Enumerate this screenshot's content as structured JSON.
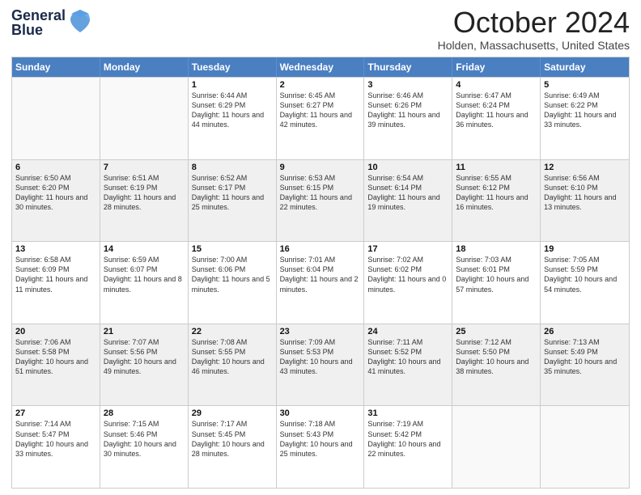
{
  "logo": {
    "line1": "General",
    "line2": "Blue",
    "aria": "GeneralBlue logo"
  },
  "title": "October 2024",
  "location": "Holden, Massachusetts, United States",
  "days_of_week": [
    "Sunday",
    "Monday",
    "Tuesday",
    "Wednesday",
    "Thursday",
    "Friday",
    "Saturday"
  ],
  "weeks": [
    [
      {
        "day": "",
        "empty": true
      },
      {
        "day": "",
        "empty": true
      },
      {
        "day": "1",
        "sunrise": "Sunrise: 6:44 AM",
        "sunset": "Sunset: 6:29 PM",
        "daylight": "Daylight: 11 hours and 44 minutes."
      },
      {
        "day": "2",
        "sunrise": "Sunrise: 6:45 AM",
        "sunset": "Sunset: 6:27 PM",
        "daylight": "Daylight: 11 hours and 42 minutes."
      },
      {
        "day": "3",
        "sunrise": "Sunrise: 6:46 AM",
        "sunset": "Sunset: 6:26 PM",
        "daylight": "Daylight: 11 hours and 39 minutes."
      },
      {
        "day": "4",
        "sunrise": "Sunrise: 6:47 AM",
        "sunset": "Sunset: 6:24 PM",
        "daylight": "Daylight: 11 hours and 36 minutes."
      },
      {
        "day": "5",
        "sunrise": "Sunrise: 6:49 AM",
        "sunset": "Sunset: 6:22 PM",
        "daylight": "Daylight: 11 hours and 33 minutes."
      }
    ],
    [
      {
        "day": "6",
        "sunrise": "Sunrise: 6:50 AM",
        "sunset": "Sunset: 6:20 PM",
        "daylight": "Daylight: 11 hours and 30 minutes."
      },
      {
        "day": "7",
        "sunrise": "Sunrise: 6:51 AM",
        "sunset": "Sunset: 6:19 PM",
        "daylight": "Daylight: 11 hours and 28 minutes."
      },
      {
        "day": "8",
        "sunrise": "Sunrise: 6:52 AM",
        "sunset": "Sunset: 6:17 PM",
        "daylight": "Daylight: 11 hours and 25 minutes."
      },
      {
        "day": "9",
        "sunrise": "Sunrise: 6:53 AM",
        "sunset": "Sunset: 6:15 PM",
        "daylight": "Daylight: 11 hours and 22 minutes."
      },
      {
        "day": "10",
        "sunrise": "Sunrise: 6:54 AM",
        "sunset": "Sunset: 6:14 PM",
        "daylight": "Daylight: 11 hours and 19 minutes."
      },
      {
        "day": "11",
        "sunrise": "Sunrise: 6:55 AM",
        "sunset": "Sunset: 6:12 PM",
        "daylight": "Daylight: 11 hours and 16 minutes."
      },
      {
        "day": "12",
        "sunrise": "Sunrise: 6:56 AM",
        "sunset": "Sunset: 6:10 PM",
        "daylight": "Daylight: 11 hours and 13 minutes."
      }
    ],
    [
      {
        "day": "13",
        "sunrise": "Sunrise: 6:58 AM",
        "sunset": "Sunset: 6:09 PM",
        "daylight": "Daylight: 11 hours and 11 minutes."
      },
      {
        "day": "14",
        "sunrise": "Sunrise: 6:59 AM",
        "sunset": "Sunset: 6:07 PM",
        "daylight": "Daylight: 11 hours and 8 minutes."
      },
      {
        "day": "15",
        "sunrise": "Sunrise: 7:00 AM",
        "sunset": "Sunset: 6:06 PM",
        "daylight": "Daylight: 11 hours and 5 minutes."
      },
      {
        "day": "16",
        "sunrise": "Sunrise: 7:01 AM",
        "sunset": "Sunset: 6:04 PM",
        "daylight": "Daylight: 11 hours and 2 minutes."
      },
      {
        "day": "17",
        "sunrise": "Sunrise: 7:02 AM",
        "sunset": "Sunset: 6:02 PM",
        "daylight": "Daylight: 11 hours and 0 minutes."
      },
      {
        "day": "18",
        "sunrise": "Sunrise: 7:03 AM",
        "sunset": "Sunset: 6:01 PM",
        "daylight": "Daylight: 10 hours and 57 minutes."
      },
      {
        "day": "19",
        "sunrise": "Sunrise: 7:05 AM",
        "sunset": "Sunset: 5:59 PM",
        "daylight": "Daylight: 10 hours and 54 minutes."
      }
    ],
    [
      {
        "day": "20",
        "sunrise": "Sunrise: 7:06 AM",
        "sunset": "Sunset: 5:58 PM",
        "daylight": "Daylight: 10 hours and 51 minutes."
      },
      {
        "day": "21",
        "sunrise": "Sunrise: 7:07 AM",
        "sunset": "Sunset: 5:56 PM",
        "daylight": "Daylight: 10 hours and 49 minutes."
      },
      {
        "day": "22",
        "sunrise": "Sunrise: 7:08 AM",
        "sunset": "Sunset: 5:55 PM",
        "daylight": "Daylight: 10 hours and 46 minutes."
      },
      {
        "day": "23",
        "sunrise": "Sunrise: 7:09 AM",
        "sunset": "Sunset: 5:53 PM",
        "daylight": "Daylight: 10 hours and 43 minutes."
      },
      {
        "day": "24",
        "sunrise": "Sunrise: 7:11 AM",
        "sunset": "Sunset: 5:52 PM",
        "daylight": "Daylight: 10 hours and 41 minutes."
      },
      {
        "day": "25",
        "sunrise": "Sunrise: 7:12 AM",
        "sunset": "Sunset: 5:50 PM",
        "daylight": "Daylight: 10 hours and 38 minutes."
      },
      {
        "day": "26",
        "sunrise": "Sunrise: 7:13 AM",
        "sunset": "Sunset: 5:49 PM",
        "daylight": "Daylight: 10 hours and 35 minutes."
      }
    ],
    [
      {
        "day": "27",
        "sunrise": "Sunrise: 7:14 AM",
        "sunset": "Sunset: 5:47 PM",
        "daylight": "Daylight: 10 hours and 33 minutes."
      },
      {
        "day": "28",
        "sunrise": "Sunrise: 7:15 AM",
        "sunset": "Sunset: 5:46 PM",
        "daylight": "Daylight: 10 hours and 30 minutes."
      },
      {
        "day": "29",
        "sunrise": "Sunrise: 7:17 AM",
        "sunset": "Sunset: 5:45 PM",
        "daylight": "Daylight: 10 hours and 28 minutes."
      },
      {
        "day": "30",
        "sunrise": "Sunrise: 7:18 AM",
        "sunset": "Sunset: 5:43 PM",
        "daylight": "Daylight: 10 hours and 25 minutes."
      },
      {
        "day": "31",
        "sunrise": "Sunrise: 7:19 AM",
        "sunset": "Sunset: 5:42 PM",
        "daylight": "Daylight: 10 hours and 22 minutes."
      },
      {
        "day": "",
        "empty": true
      },
      {
        "day": "",
        "empty": true
      }
    ]
  ]
}
